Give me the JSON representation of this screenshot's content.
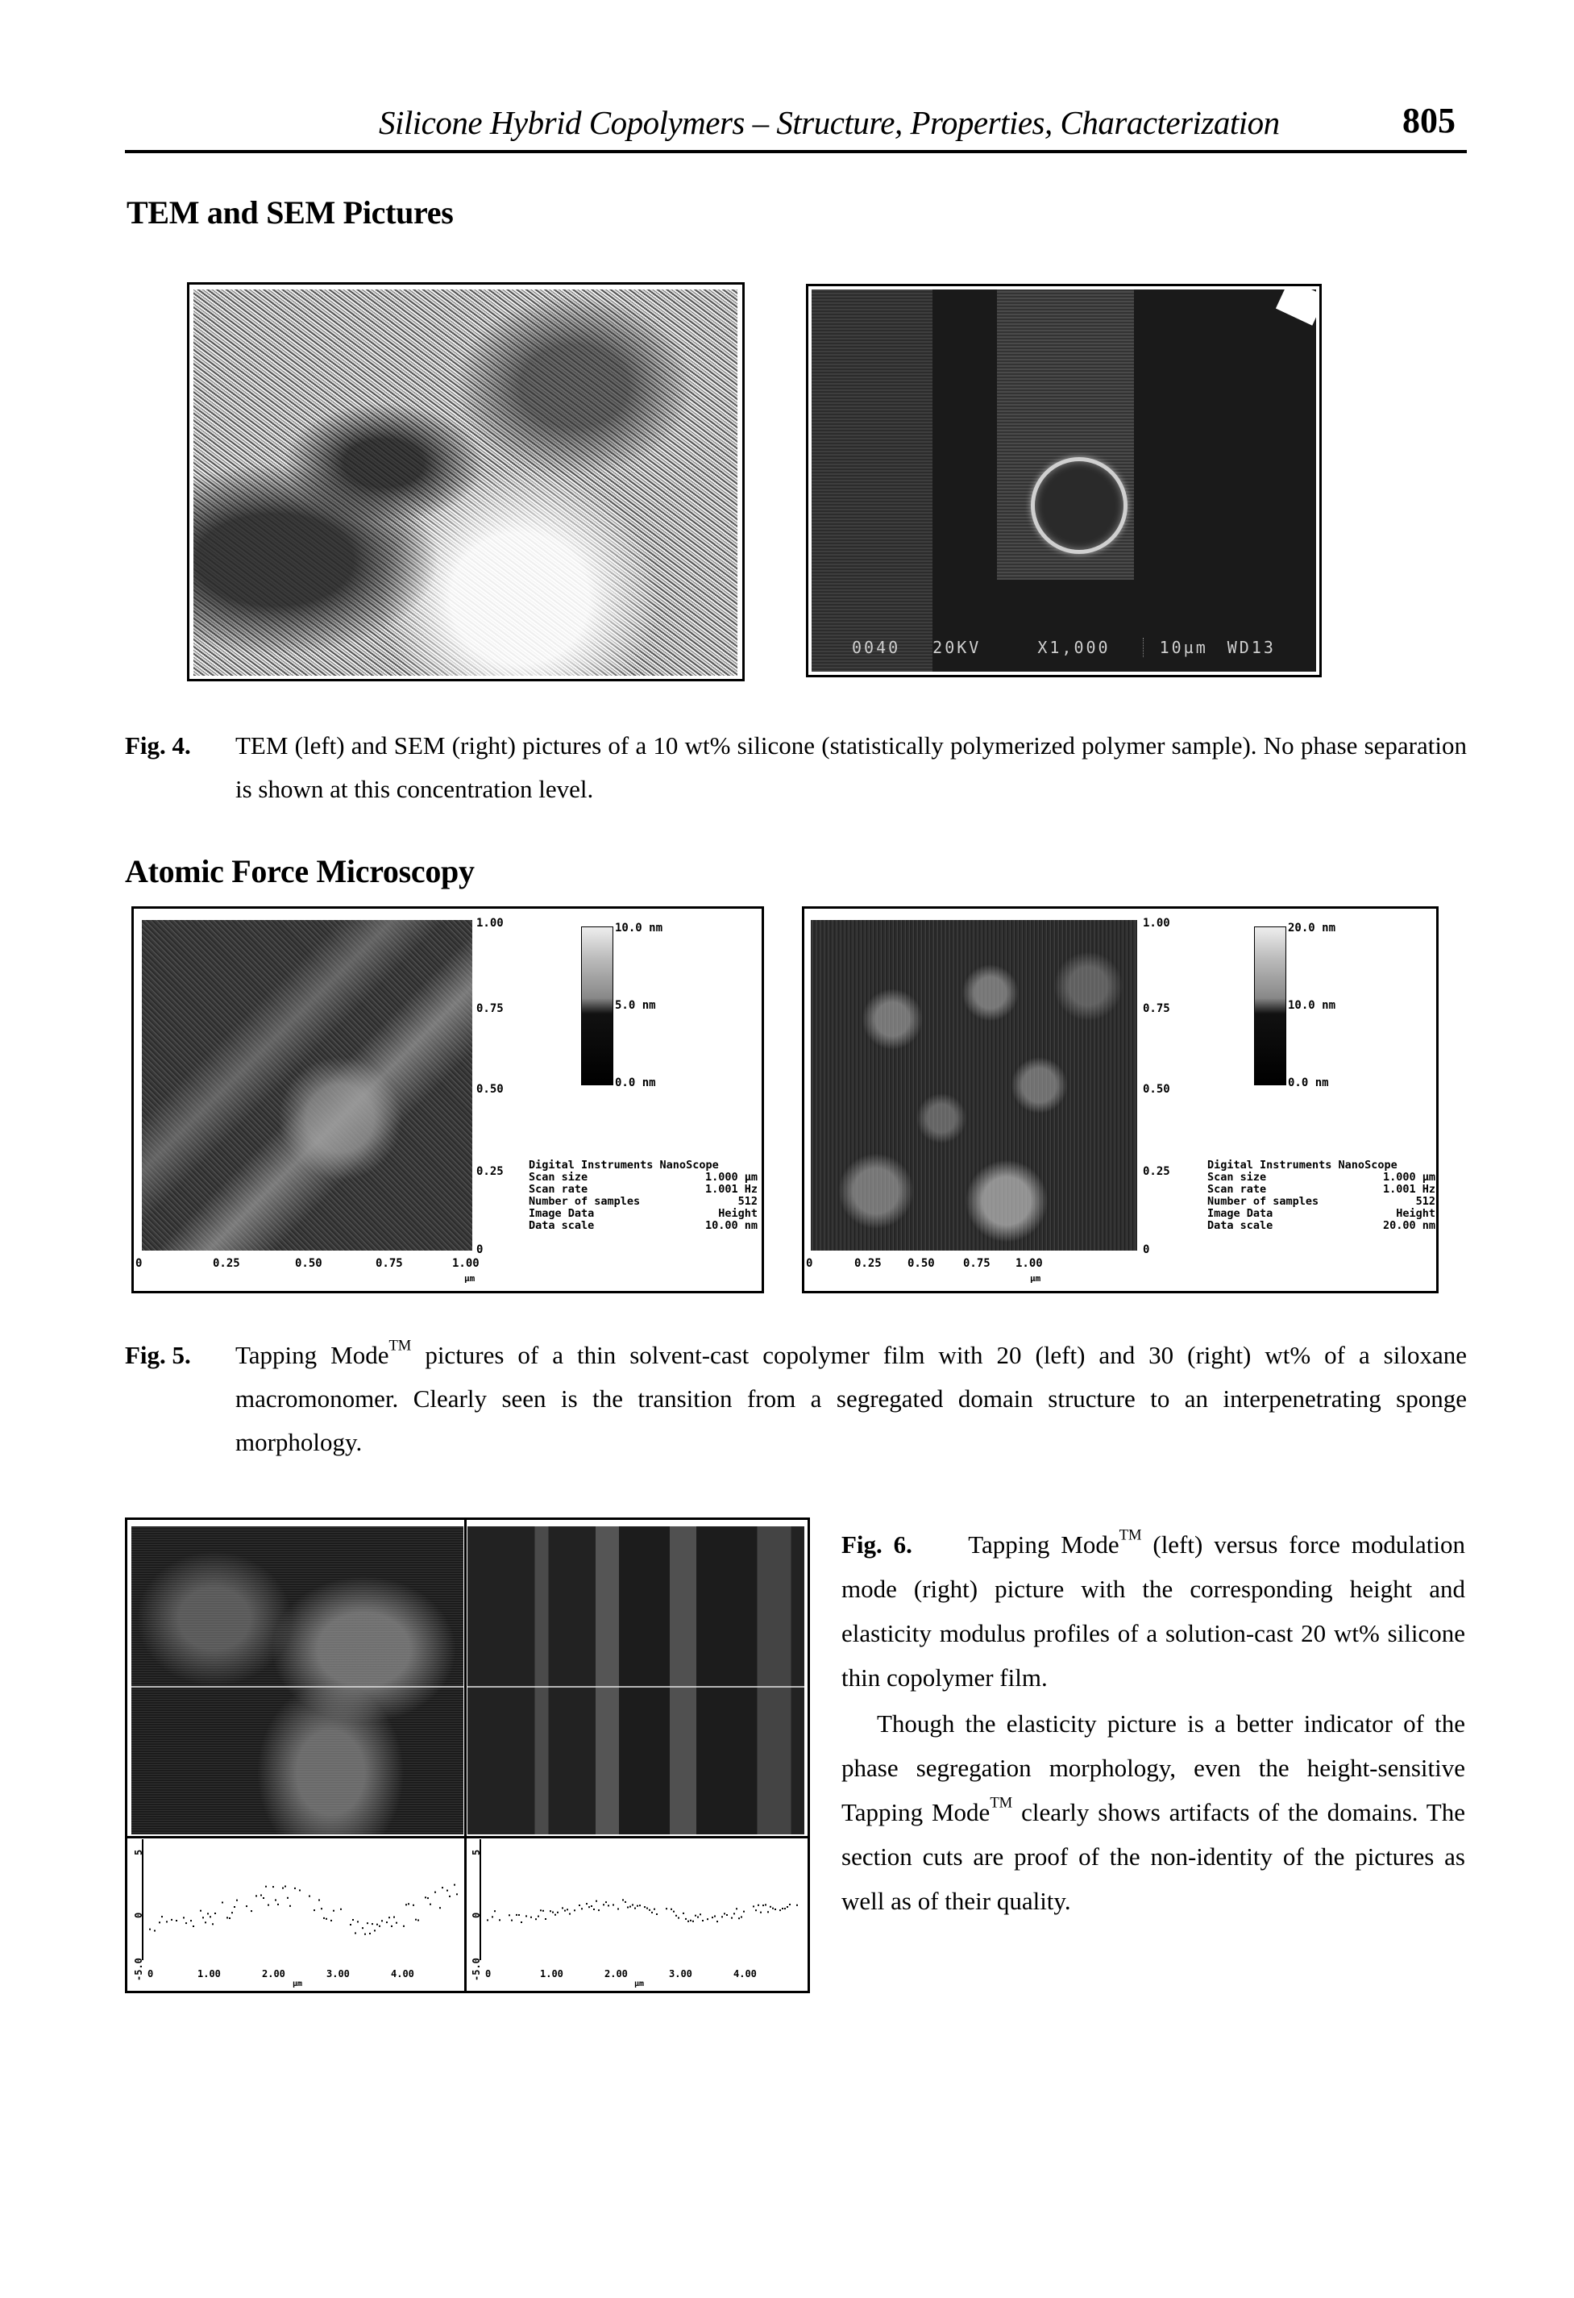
{
  "header": {
    "running_title": "Silicone Hybrid Copolymers – Structure, Properties, Characterization",
    "page_number": "805"
  },
  "sections": {
    "tem_sem": "TEM and SEM Pictures",
    "afm": "Atomic Force Microscopy"
  },
  "fig4": {
    "label": "Fig. 4.",
    "caption": "TEM (left) and SEM (right) pictures of a 10 wt% silicone (statistically polymerized polymer sample). No phase separation is shown at this concentration level.",
    "sem_info": [
      "0040",
      "20KV",
      "X1,000",
      "10µm",
      "WD13"
    ]
  },
  "fig5": {
    "label": "Fig. 5.",
    "caption_pre": "Tapping Mode",
    "caption_tm": "TM",
    "caption_post": " pictures of a thin solvent-cast copolymer film with 20 (left) and 30 (right) wt% of a siloxane macromonomer. Clearly seen is the transition from a segregated domain structure to an interpenetrating sponge morphology.",
    "left": {
      "y_ticks": [
        "1.00",
        "0.75",
        "0.50",
        "0.25",
        "0"
      ],
      "x_ticks": [
        "0",
        "0.25",
        "0.50",
        "0.75",
        "1.00"
      ],
      "x_unit": "µm",
      "colorbar": [
        "10.0 nm",
        "5.0 nm",
        "0.0 nm"
      ],
      "info": [
        {
          "key": "Digital Instruments NanoScope",
          "value": ""
        },
        {
          "key": "Scan size",
          "value": "1.000 µm"
        },
        {
          "key": "Scan rate",
          "value": "1.001 Hz"
        },
        {
          "key": "Number of samples",
          "value": "512"
        },
        {
          "key": "Image Data",
          "value": "Height"
        },
        {
          "key": "Data scale",
          "value": "10.00 nm"
        }
      ]
    },
    "right": {
      "y_ticks": [
        "1.00",
        "0.75",
        "0.50",
        "0.25",
        "0"
      ],
      "x_ticks": [
        "0",
        "0.25",
        "0.50",
        "0.75",
        "1.00"
      ],
      "x_unit": "µm",
      "colorbar": [
        "20.0 nm",
        "10.0 nm",
        "0.0 nm"
      ],
      "info": [
        {
          "key": "Digital Instruments NanoScope",
          "value": ""
        },
        {
          "key": "Scan size",
          "value": "1.000 µm"
        },
        {
          "key": "Scan rate",
          "value": "1.001 Hz"
        },
        {
          "key": "Number of samples",
          "value": "512"
        },
        {
          "key": "Image Data",
          "value": "Height"
        },
        {
          "key": "Data scale",
          "value": "20.00 nm"
        }
      ]
    }
  },
  "fig6": {
    "label": "Fig. 6.",
    "caption_a": "Tapping Mode",
    "caption_tm": "TM",
    "caption_b": " (left) versus force modulation mode (right) picture with the corresponding height and elasticity modulus profiles of a solution-cast 20 wt% silicone thin copolymer film.",
    "para_a": "Though the elasticity picture is a better indicator of the phase segregation morphology, even the height-sensitive Tapping Mode",
    "para_tm": "TM",
    "para_b": " clearly shows artifacts of the domains. The section cuts are proof of the non-identity of the pictures as well as of their quality.",
    "profile_left": {
      "y_ticks": [
        "5",
        "0",
        "-5.0"
      ],
      "x_ticks": [
        "0",
        "1.00",
        "2.00",
        "3.00",
        "4.00"
      ],
      "x_unit": "µm"
    },
    "profile_right": {
      "y_ticks": [
        "5",
        "0",
        "-5.0"
      ],
      "x_ticks": [
        "0",
        "1.00",
        "2.00",
        "3.00",
        "4.00"
      ],
      "x_unit": "µm"
    }
  }
}
